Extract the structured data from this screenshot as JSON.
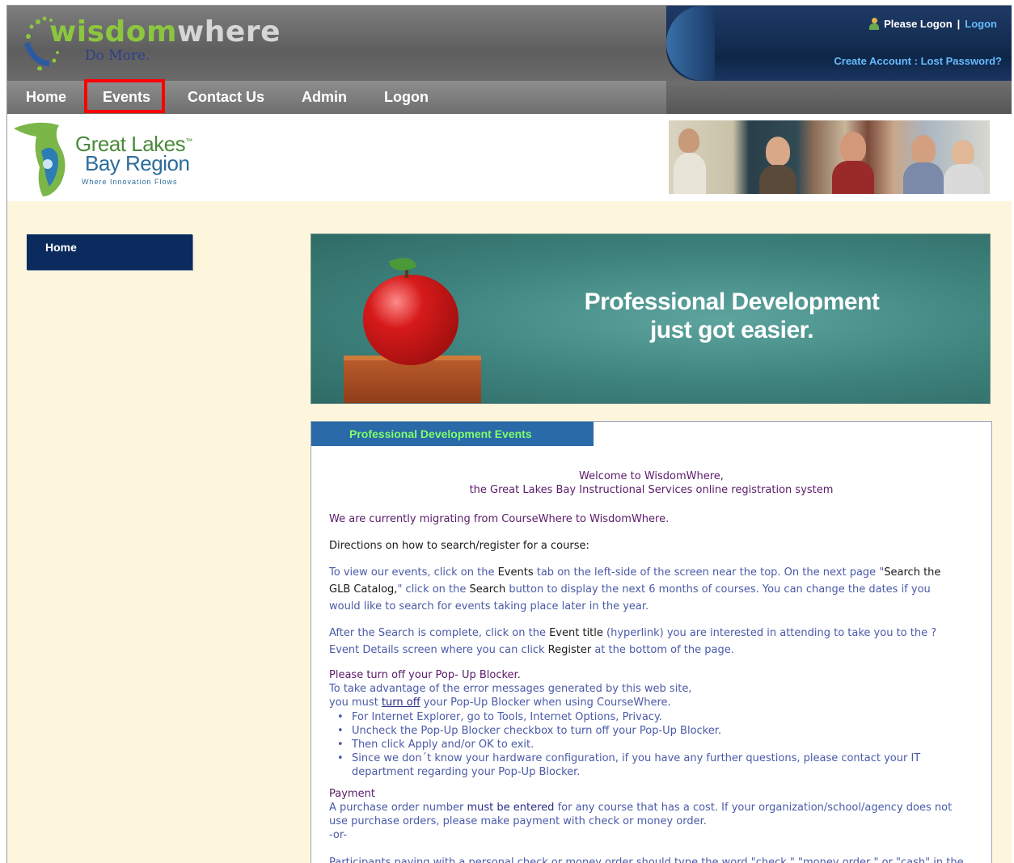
{
  "header": {
    "logo_word1": "wisdom",
    "logo_word2": "where",
    "logo_tagline": "Do More.",
    "please_logon": "Please Logon",
    "separator": "|",
    "logon_link": "Logon",
    "create_account": "Create Account",
    "lost_password": "Lost Password?",
    "account_separator": ":"
  },
  "nav": {
    "items": [
      {
        "label": "Home"
      },
      {
        "label": "Events"
      },
      {
        "label": "Contact Us"
      },
      {
        "label": "Admin"
      },
      {
        "label": "Logon"
      }
    ]
  },
  "brand": {
    "line1": "Great Lakes",
    "tm": "™",
    "line2": "Bay Region",
    "line3": "Where Innovation Flows"
  },
  "sidebar": {
    "home_label": "Home"
  },
  "hero": {
    "line1": "Professional Development",
    "line2": "just got easier."
  },
  "content": {
    "tab_label": "Professional Development Events",
    "welcome1": "Welcome to WisdomWhere,",
    "welcome2": "the Great Lakes Bay Instructional Services online registration system",
    "migrating": "We are currently migrating from CourseWhere to WisdomWhere.",
    "directions": "Directions on how to search/register for a course:",
    "p1_a": "To view our events, click on the ",
    "p1_b": "Events",
    "p1_c": " tab on the left-side of the screen near the top. On the next page  \"",
    "p1_d": "Search the",
    "p1_e": "GLB Catalog,",
    "p1_f": "\" click on the ",
    "p1_g": "Search",
    "p1_h": " button to display the next 6 months of courses. You can change the dates if you",
    "p1_i": "would like to search for events taking place later in the year.",
    "p2_a": "After the Search is complete, click on the ",
    "p2_b": "Event title",
    "p2_c": " (hyperlink) you are interested in attending to take you to the ?",
    "p2_d": "Event Details screen where you can click ",
    "p2_e": "Register",
    "p2_f": " at the bottom of the page.",
    "popup_title": "Please turn off your Pop- Up Blocker.",
    "popup_l1": "To take advantage of the error messages generated by this web site,",
    "popup_l2a": "you must ",
    "popup_l2b": "turn off",
    "popup_l2c": " your Pop-Up Blocker when using CourseWhere.",
    "bullets": [
      "For Internet Explorer, go to Tools, Internet Options, Privacy.",
      "Uncheck the Pop-Up Blocker checkbox to turn off your Pop-Up Blocker.",
      "Then click Apply and/or OK to exit.",
      "Since we don´t know your hardware configuration, if you have any further questions, please contact your IT",
      "department regarding your Pop-Up Blocker."
    ],
    "payment_title": "Payment",
    "pay_l1a": "A purchase order number ",
    "pay_l1b": "must be entered",
    "pay_l1c": " for any course that has a cost. If your organization/school/agency does not",
    "pay_l2": "use purchase orders, please make payment with check or money order.",
    "pay_or": "-or-",
    "pay_last": "Participants paying with a personal check or money order should type the word \"check,\" \"money order,\" or \"cash\" in the"
  },
  "colors": {
    "nav_bg": "#7a7a7a",
    "sidebar_home_bg": "#0b2b5e",
    "tab_bg": "#2a6aa8",
    "tab_text": "#7fff6a",
    "highlight": "#ff0000",
    "page_bg": "#fdf6dc"
  }
}
